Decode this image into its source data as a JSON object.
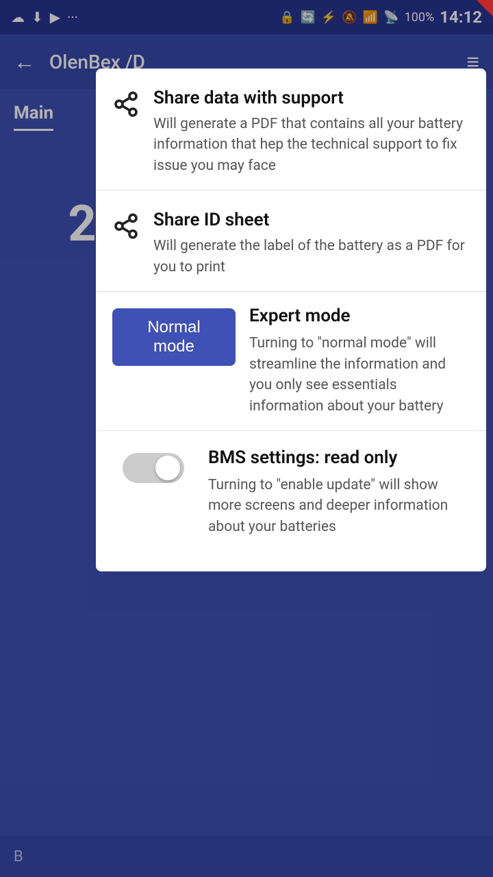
{
  "statusBar": {
    "leftIcons": [
      "cloud-icon",
      "download-icon",
      "youtube-icon",
      "more-icon"
    ],
    "rightIcons": [
      "lock-icon",
      "sync-icon",
      "bluetooth-icon",
      "mute-icon",
      "wifi-icon",
      "signal-icon"
    ],
    "battery": "100%",
    "time": "14:12"
  },
  "appBar": {
    "title": "OlenBex /D",
    "backLabel": "←"
  },
  "debugBadge": "DEBUG",
  "mainTab": "Main",
  "bgCard": {
    "number": "2"
  },
  "bottomBar": {
    "text": "B"
  },
  "menu": {
    "shareDataTitle": "Share data with support",
    "shareDataDesc": "Will generate a PDF that contains all your battery information that hep the technical support to fix issue you may face",
    "shareIdTitle": "Share ID sheet",
    "shareIdDesc": "Will generate the label of the battery as a PDF for you to print"
  },
  "expertMode": {
    "buttonLabel": "Normal mode",
    "title": "Expert mode",
    "desc": "Turning to \"normal mode\" will streamline the information and you only see essentials information about your battery"
  },
  "bmsSettings": {
    "title": "BMS settings: read only",
    "desc": "Turning to \"enable update\" will show more screens and deeper information about your batteries",
    "toggleState": false
  }
}
